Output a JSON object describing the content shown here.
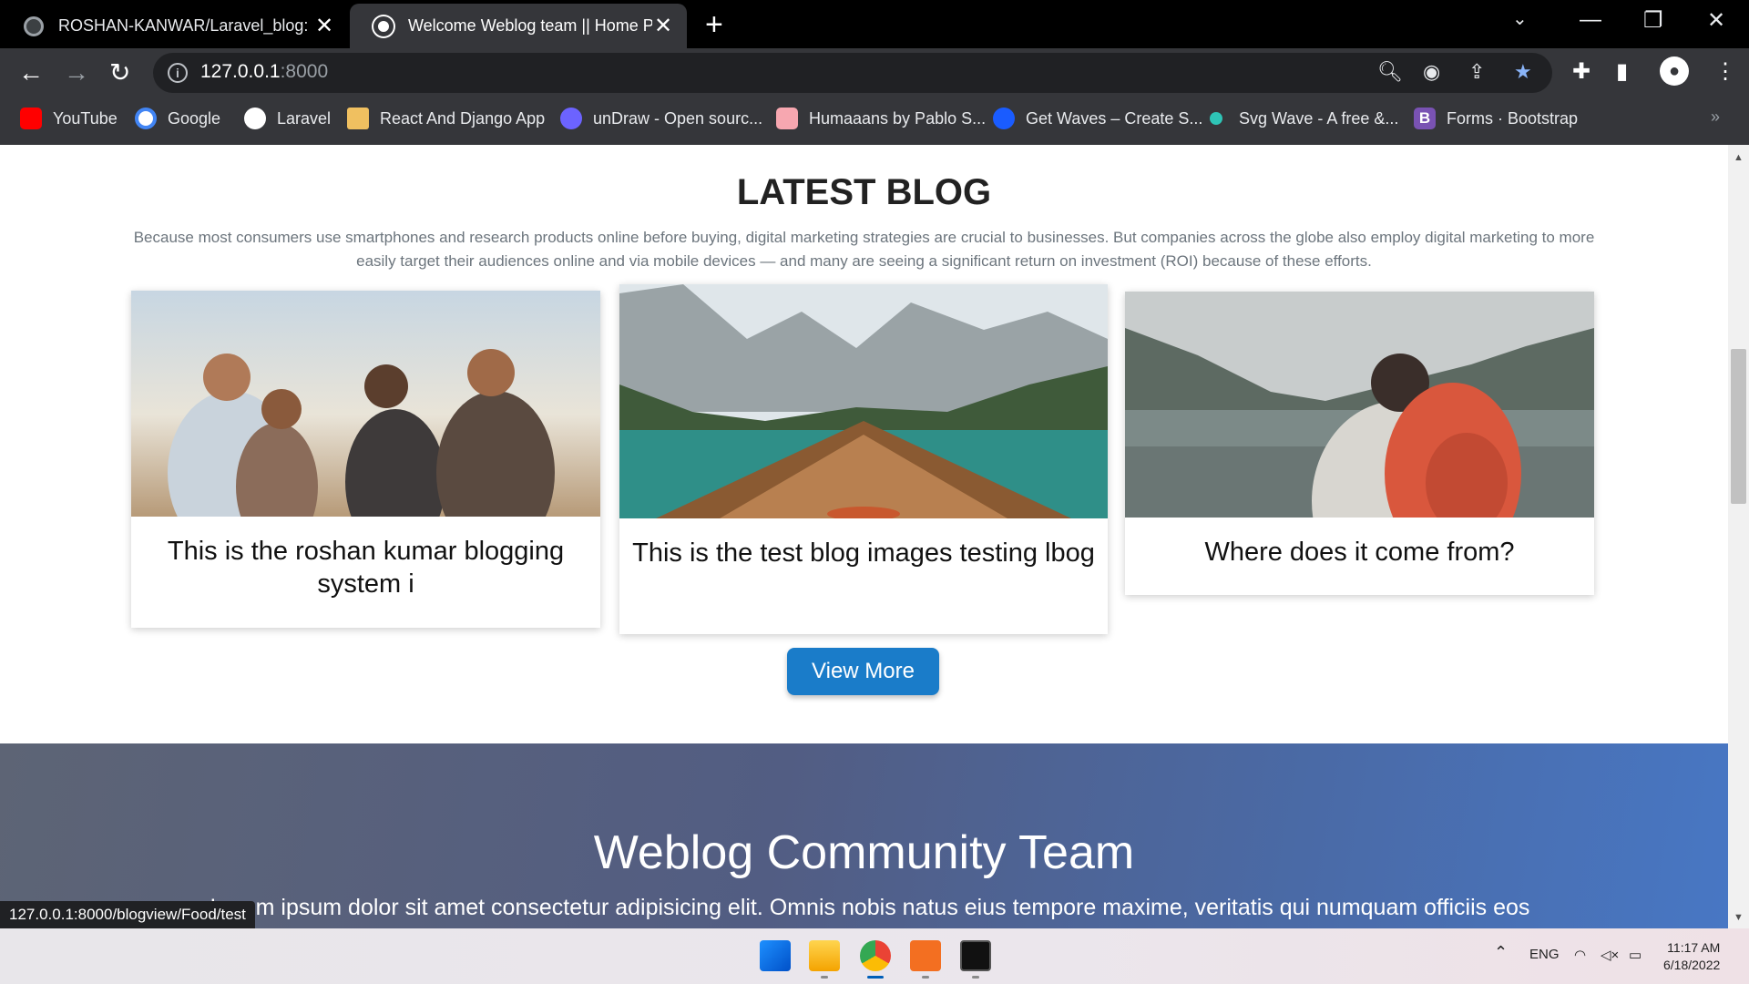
{
  "browser": {
    "tabs": [
      {
        "title": "ROSHAN-KANWAR/Laravel_blog: Bl",
        "active": false
      },
      {
        "title": "Welcome Weblog team || Home Pag",
        "active": true
      }
    ],
    "url_host": "127.0.0.1",
    "url_port": ":8000",
    "bookmarks": [
      {
        "label": "YouTube",
        "icon": "youtube-icon",
        "color": "#ff0000"
      },
      {
        "label": "Google",
        "icon": "google-icon",
        "color": "#ffffff"
      },
      {
        "label": "Laravel",
        "icon": "globe-icon",
        "color": "#ffffff"
      },
      {
        "label": "React And Django App",
        "icon": "react-django-icon",
        "color": "#f0c060"
      },
      {
        "label": "unDraw - Open sourc...",
        "icon": "undraw-icon",
        "color": "#6c63ff"
      },
      {
        "label": "Humaaans by Pablo S...",
        "icon": "humaaans-icon",
        "color": "#f7a7b0"
      },
      {
        "label": "Get Waves – Create S...",
        "icon": "waves-icon",
        "color": "#1a5cff"
      },
      {
        "label": "Svg Wave - A free &...",
        "icon": "svgwave-icon",
        "color": "#2ec4b6"
      },
      {
        "label": "Forms · Bootstrap",
        "icon": "bootstrap-icon",
        "color": "#7952b3"
      }
    ]
  },
  "page": {
    "section_title": "LATEST BLOG",
    "section_description": "Because most consumers use smartphones and research products online before buying, digital marketing strategies are crucial to businesses. But companies across the globe also employ digital marketing to more easily target their audiences online and via mobile devices — and many are seeing a significant return on investment (ROI) because of these efforts.",
    "cards": [
      {
        "title": "This is the roshan kumar blogging system i",
        "image": "friends-laughing-photo"
      },
      {
        "title": "This is the test blog images testing lbog",
        "image": "boat-lake-mountains-photo"
      },
      {
        "title": "Where does it come from?",
        "image": "hiker-backpack-lake-photo"
      }
    ],
    "view_more_label": "View More",
    "community_title": "Weblog Community Team",
    "community_text": "Lorem ipsum dolor sit amet consectetur adipisicing elit. Omnis nobis natus eius tempore maxime, veritatis qui numquam officiis eos",
    "status_link": "127.0.0.1:8000/blogview/Food/test"
  },
  "taskbar": {
    "language": "ENG",
    "time": "11:17 AM",
    "date": "6/18/2022"
  },
  "colors": {
    "button": "#1a7cc9",
    "community_gradient_start": "#5d6475",
    "community_gradient_end": "#4877c4"
  }
}
